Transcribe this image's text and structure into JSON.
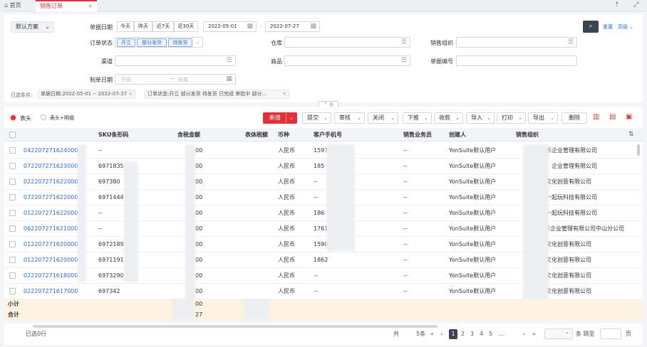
{
  "tabs": {
    "home": "首页",
    "active": "销售订单",
    "close": "×"
  },
  "filter": {
    "scheme": "默认方案",
    "doc_date_label": "单据日期",
    "date_presets": [
      "今天",
      "昨天",
      "近7天",
      "近30天"
    ],
    "date_from": "2022-05-01",
    "date_sep": "-",
    "date_to": "2022-07-27",
    "order_status_label": "订单状态",
    "status_tags": [
      "开立",
      "部分发货",
      "待发货"
    ],
    "warehouse_label": "仓库",
    "sales_org_label": "销售组织",
    "channel_label": "渠道",
    "product_label": "商品",
    "doc_no_label": "单据编号",
    "create_date_label": "制单日期",
    "create_start_placeholder": "开始",
    "create_range_sep": "~",
    "create_end_placeholder": "结束",
    "reset_label": "重置",
    "advanced_label": "高级",
    "selected_label": "已选条件:",
    "conditions": [
      "单据日期:2022-05-01 -- 2022-07-27",
      "订单状态:开立 部分发货 待发货 已完成 审批中 部分..."
    ]
  },
  "view": {
    "header_only": "表头",
    "header_detail": "表头+明细"
  },
  "toolbar": {
    "new": "新增",
    "submit": "提交",
    "audit": "审核",
    "close": "关闭",
    "push_down": "下推",
    "receive": "收款",
    "import": "导入",
    "print": "打印",
    "export": "导出",
    "delete": "删除"
  },
  "columns": [
    "",
    "SKU条形码",
    "含税金额",
    "表体税额",
    "币种",
    "客户手机号",
    "销售业务员",
    "创建人",
    "销售组织"
  ],
  "rows": [
    {
      "code": "042207271624000",
      "sku": "--",
      "amount": "00",
      "tax": "",
      "currency": "人民币",
      "phone": "1597",
      "salesman": "--",
      "creator": "YonSuite默认用户",
      "org": "乐企业管理有限公司"
    },
    {
      "code": "072207271623000",
      "sku": "6971835",
      "amount": "00",
      "tax": "",
      "currency": "人民币",
      "phone": "185",
      "salesman": "--",
      "creator": "YonSuite默认用户",
      "org": "企业管理有限公司"
    },
    {
      "code": "022207271622000",
      "sku": "697380",
      "amount": "00",
      "tax": "",
      "currency": "人民币",
      "phone": "--",
      "salesman": "--",
      "creator": "YonSuite默认用户",
      "org": "文化创意有限公司"
    },
    {
      "code": "072207271622000",
      "sku": "6971444",
      "amount": "00",
      "tax": "",
      "currency": "人民币",
      "phone": "--",
      "salesman": "--",
      "creator": "YonSuite默认用户",
      "org": "一起玩科技有限公司"
    },
    {
      "code": "012207271622000",
      "sku": "--",
      "amount": "00",
      "tax": "",
      "currency": "人民币",
      "phone": "186",
      "salesman": "--",
      "creator": "YonSuite默认用户",
      "org": "一起玩科技有限公司"
    },
    {
      "code": "062207271621000",
      "sku": "--",
      "amount": "00",
      "tax": "",
      "currency": "人民币",
      "phone": "1761",
      "salesman": "--",
      "creator": "YonSuite默认用户",
      "org": "乐企业管理有限公司中山分公司"
    },
    {
      "code": "012207271620000",
      "sku": "6972189",
      "amount": "00",
      "tax": "",
      "currency": "人民币",
      "phone": "1590",
      "salesman": "--",
      "creator": "YonSuite默认用户",
      "org": "文化创意有限公司"
    },
    {
      "code": "012207271620000",
      "sku": "6971191",
      "amount": "00",
      "tax": "",
      "currency": "人民币",
      "phone": "1862",
      "salesman": "--",
      "creator": "YonSuite默认用户",
      "org": "文化创意有限公司"
    },
    {
      "code": "022207271618000",
      "sku": "6973290",
      "amount": "00",
      "tax": "",
      "currency": "人民币",
      "phone": "--",
      "salesman": "--",
      "creator": "YonSuite默认用户",
      "org": "文化创意有限公司"
    },
    {
      "code": "022207271617000",
      "sku": "697342",
      "amount": "00",
      "tax": "",
      "currency": "人民币",
      "phone": "--",
      "salesman": "--",
      "creator": "YonSuite默认用户",
      "org": "文化创意有限公司"
    }
  ],
  "summary": {
    "subtotal_label": "小计",
    "subtotal_value": "00",
    "total_label": "合计",
    "total_value": "27"
  },
  "pager": {
    "selected": "已选0行",
    "total_prefix": "共",
    "total_suffix": "5条",
    "pages": [
      "1",
      "2",
      "3",
      "4",
      "5",
      "..."
    ],
    "goto_label": "条 跳至",
    "page_unit": "页"
  },
  "colors": {
    "accent": "#e0303a",
    "link": "#2f6fd3",
    "summary_bg": "#fdf3e3"
  },
  "icons": [
    "home-icon",
    "calendar-icon",
    "list-icon",
    "search-icon",
    "settings-icon",
    "fullscreen-icon",
    "collapse-icon"
  ]
}
